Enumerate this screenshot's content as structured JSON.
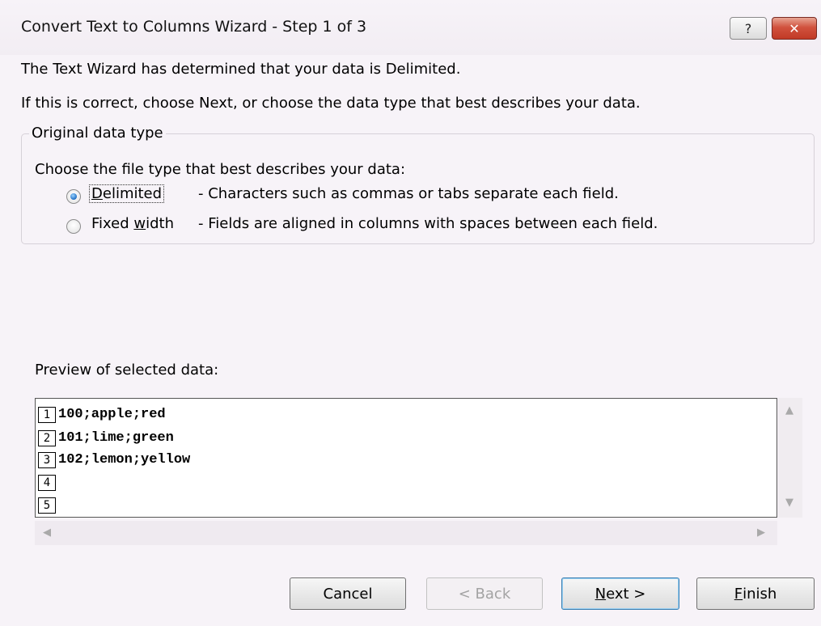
{
  "window": {
    "title": "Convert Text to Columns Wizard - Step 1 of 3",
    "help_label": "?",
    "close_label": "✕"
  },
  "intro": {
    "line1": "The Text Wizard has determined that your data is Delimited.",
    "line2": "If this is correct, choose Next, or choose the data type that best describes your data."
  },
  "original_data_type": {
    "legend": "Original data type",
    "prompt": "Choose the file type that best describes your data:",
    "options": [
      {
        "label": "Delimited",
        "underline_char": "D",
        "label_rest": "elimited",
        "description": "- Characters such as commas or tabs separate each field.",
        "selected": true
      },
      {
        "label": "Fixed width",
        "label_pre": "Fixed ",
        "underline_char": "w",
        "label_rest": "idth",
        "description": "- Fields are aligned in columns with spaces between each field.",
        "selected": false
      }
    ]
  },
  "preview": {
    "label": "Preview of selected data:",
    "rows": [
      {
        "num": "1",
        "text": "100;apple;red"
      },
      {
        "num": "2",
        "text": "101;lime;green"
      },
      {
        "num": "3",
        "text": "102;lemon;yellow"
      },
      {
        "num": "4",
        "text": ""
      },
      {
        "num": "5",
        "text": ""
      }
    ]
  },
  "buttons": {
    "cancel": "Cancel",
    "back": "< Back",
    "next_underline": "N",
    "next_rest": "ext >",
    "finish_underline": "F",
    "finish_rest": "inish"
  }
}
